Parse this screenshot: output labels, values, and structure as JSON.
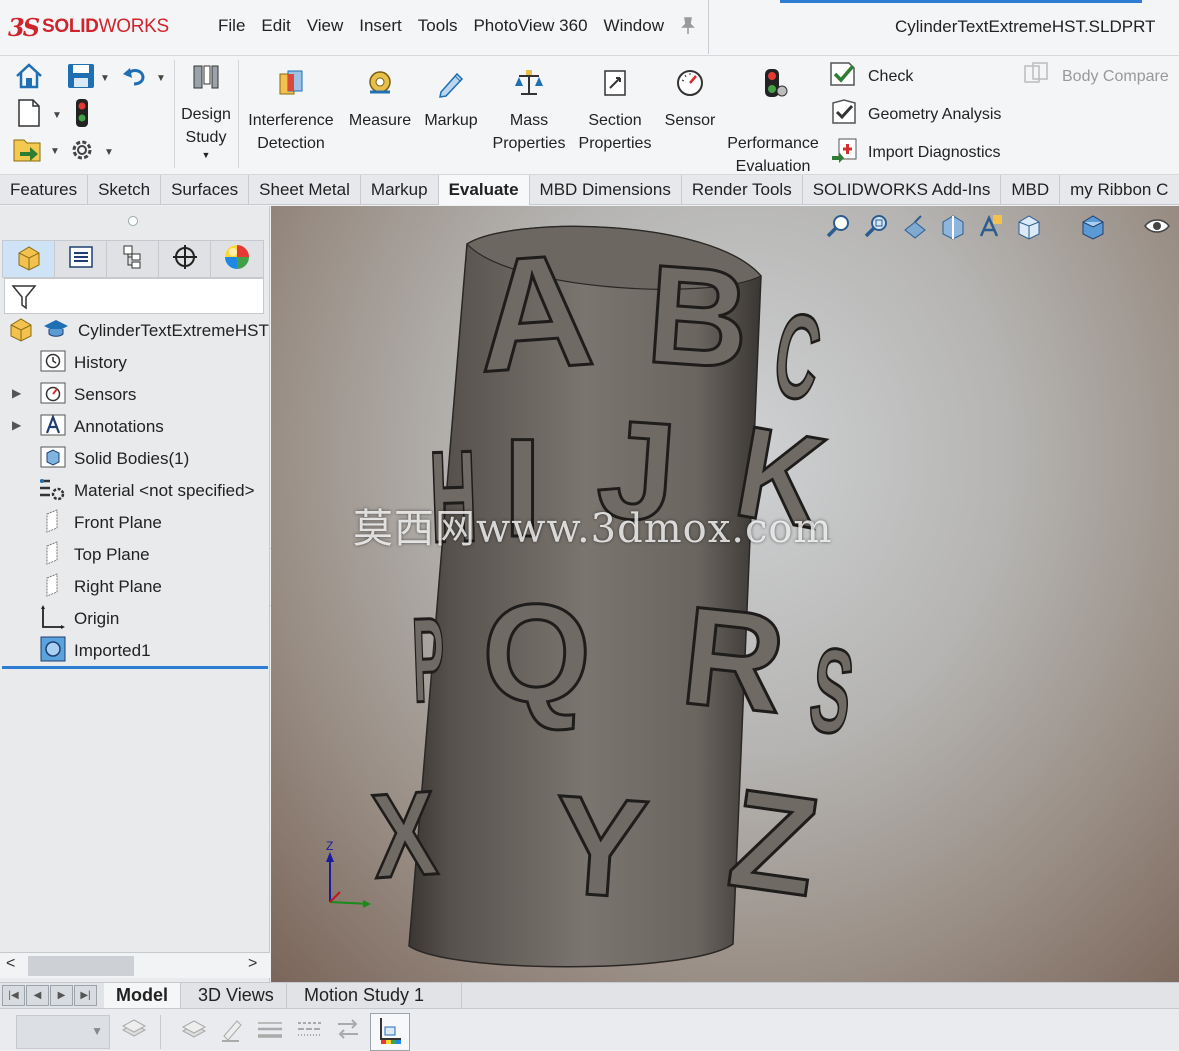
{
  "app": {
    "brand_ds": "3S",
    "brand_name_bold": "SOLID",
    "brand_name_light": "WORKS"
  },
  "menu": [
    "File",
    "Edit",
    "View",
    "Insert",
    "Tools",
    "PhotoView 360",
    "Window"
  ],
  "document_title": "CylinderTextExtremeHST.SLDPRT",
  "ribbon": {
    "design_study": "Design Study",
    "design_study_l1": "Design",
    "design_study_l2": "Study",
    "interference_l1": "Interference",
    "interference_l2": "Detection",
    "measure": "Measure",
    "markup": "Markup",
    "mass_l1": "Mass",
    "mass_l2": "Properties",
    "section_l1": "Section",
    "section_l2": "Properties",
    "sensor": "Sensor",
    "performance_l1": "Performance",
    "performance_l2": "Evaluation",
    "check": "Check",
    "geometry_analysis": "Geometry Analysis",
    "import_diagnostics": "Import Diagnostics",
    "body_compare": "Body Compare"
  },
  "command_tabs": [
    "Features",
    "Sketch",
    "Surfaces",
    "Sheet Metal",
    "Markup",
    "Evaluate",
    "MBD Dimensions",
    "Render Tools",
    "SOLIDWORKS Add-Ins",
    "MBD",
    "my Ribbon C"
  ],
  "active_command_tab": "Evaluate",
  "feature_tree": {
    "root": "CylinderTextExtremeHST",
    "items": [
      {
        "label": "History",
        "icon": "history-icon"
      },
      {
        "label": "Sensors",
        "icon": "sensor-icon"
      },
      {
        "label": "Annotations",
        "icon": "annotations-icon"
      },
      {
        "label": "Solid Bodies(1)",
        "icon": "solid-bodies-icon"
      },
      {
        "label": "Material <not specified>",
        "icon": "material-icon"
      },
      {
        "label": "Front Plane",
        "icon": "plane-icon"
      },
      {
        "label": "Top Plane",
        "icon": "plane-icon"
      },
      {
        "label": "Right Plane",
        "icon": "plane-icon"
      },
      {
        "label": "Origin",
        "icon": "origin-icon"
      },
      {
        "label": "Imported1",
        "icon": "imported-body-icon"
      }
    ]
  },
  "viewport": {
    "watermark": "莫西网www.3dmox.com",
    "engraved_letters": [
      "A",
      "B",
      "C",
      "H",
      "I",
      "J",
      "K",
      "P",
      "Q",
      "R",
      "S",
      "X",
      "Y",
      "Z"
    ],
    "triad_axis_label": "Z"
  },
  "bottom_tabs": [
    "Model",
    "3D Views",
    "Motion Study 1"
  ],
  "active_bottom_tab": "Model",
  "colors": {
    "accent": "#2d7dd2",
    "brand_red": "#d0242c"
  }
}
